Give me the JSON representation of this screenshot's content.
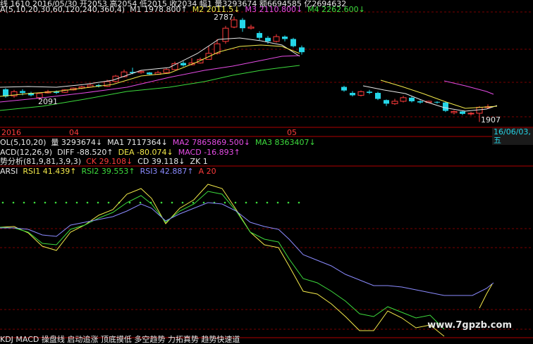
{
  "header": {
    "line1": "线 1610 2016/05/30 开2053 高2054 低2015 收2034 幅1 量3293674 额6694585 亿2694632",
    "ma_prefix": "A(5,10,20,30,60,120,240,360,4)",
    "m1": "M1 1978.800↑",
    "m2": "M2 2011.5↓",
    "m3": "M3 2110.800↓",
    "m4": "M4 2262.600↓"
  },
  "volume_header": {
    "prefix": "OL(5,10,20)",
    "vol": "量 3293674↓",
    "ma1": "MA1 7117364↓",
    "ma2": "MA2 7865869.500↓",
    "ma3": "MA3 8363407↓"
  },
  "macd_header": {
    "prefix": "ACD(12,26,9)",
    "diff": "DIFF -88.520↑",
    "dea": "DEA -80.074↓",
    "macd": "MACD -16.893↑"
  },
  "trend_header": {
    "prefix": "势分析(81,9,81,3,9,3)",
    "ck": "CK 29.108↓",
    "cd": "CD 39.118↓",
    "zk": "ZK 1"
  },
  "rsi_header": {
    "prefix": "ARSI",
    "rsi1": "RSI1 41.439↑",
    "rsi2": "RSI2 39.553↑",
    "rsi3": "RSI3 42.887↑",
    "a": "A 20"
  },
  "axis": {
    "date_labels": [
      "2016",
      "04",
      "05"
    ],
    "selected_date": "16/06/03,五"
  },
  "annotations": {
    "high": "2787",
    "low_left": "2091",
    "low_right": "1907"
  },
  "footer": {
    "text": "KDJ MACD 操盘线 启动追涨 顶底摸低 多空趋势 力拓真势 趋势快速道"
  },
  "watermark": "www.7gpzb.com",
  "colors": {
    "up": "#ff3b3b",
    "down": "#25d6e8",
    "ma1": "#e8e8e8",
    "ma2": "#f3e94a",
    "ma3": "#e64ce6",
    "ma4": "#3ddc3d"
  },
  "chart_data": {
    "type": "candlestick",
    "candles": [
      {
        "o": 2180,
        "c": 2120,
        "h": 2190,
        "l": 2110
      },
      {
        "o": 2125,
        "c": 2160,
        "h": 2175,
        "l": 2110
      },
      {
        "o": 2165,
        "c": 2150,
        "h": 2180,
        "l": 2130
      },
      {
        "o": 2150,
        "c": 2130,
        "h": 2160,
        "l": 2120
      },
      {
        "o": 2110,
        "c": 2145,
        "h": 2150,
        "l": 2091
      },
      {
        "o": 2150,
        "c": 2160,
        "h": 2175,
        "l": 2145
      },
      {
        "o": 2160,
        "c": 2150,
        "h": 2170,
        "l": 2140
      },
      {
        "o": 2155,
        "c": 2175,
        "h": 2180,
        "l": 2150
      },
      {
        "o": 2175,
        "c": 2190,
        "h": 2195,
        "l": 2170
      },
      {
        "o": 2190,
        "c": 2200,
        "h": 2210,
        "l": 2180
      },
      {
        "o": 2200,
        "c": 2215,
        "h": 2230,
        "l": 2195
      },
      {
        "o": 2215,
        "c": 2205,
        "h": 2225,
        "l": 2195
      },
      {
        "o": 2205,
        "c": 2245,
        "h": 2260,
        "l": 2200
      },
      {
        "o": 2245,
        "c": 2290,
        "h": 2300,
        "l": 2240
      },
      {
        "o": 2285,
        "c": 2325,
        "h": 2345,
        "l": 2280
      },
      {
        "o": 2325,
        "c": 2315,
        "h": 2360,
        "l": 2305
      },
      {
        "o": 2320,
        "c": 2330,
        "h": 2340,
        "l": 2310
      },
      {
        "o": 2320,
        "c": 2305,
        "h": 2325,
        "l": 2300
      },
      {
        "o": 2305,
        "c": 2320,
        "h": 2335,
        "l": 2300
      },
      {
        "o": 2320,
        "c": 2345,
        "h": 2355,
        "l": 2315
      },
      {
        "o": 2345,
        "c": 2395,
        "h": 2410,
        "l": 2340
      },
      {
        "o": 2400,
        "c": 2380,
        "h": 2415,
        "l": 2370
      },
      {
        "o": 2385,
        "c": 2400,
        "h": 2440,
        "l": 2380
      },
      {
        "o": 2400,
        "c": 2430,
        "h": 2445,
        "l": 2395
      },
      {
        "o": 2430,
        "c": 2480,
        "h": 2540,
        "l": 2430
      },
      {
        "o": 2480,
        "c": 2560,
        "h": 2600,
        "l": 2470
      },
      {
        "o": 2580,
        "c": 2690,
        "h": 2710,
        "l": 2560
      },
      {
        "o": 2700,
        "c": 2760,
        "h": 2787,
        "l": 2690
      },
      {
        "o": 2760,
        "c": 2690,
        "h": 2775,
        "l": 2660
      },
      {
        "o": 2690,
        "c": 2700,
        "h": 2720,
        "l": 2680
      },
      {
        "o": 2650,
        "c": 2610,
        "h": 2665,
        "l": 2590
      },
      {
        "o": 2610,
        "c": 2580,
        "h": 2625,
        "l": 2560
      },
      {
        "o": 2580,
        "c": 2620,
        "h": 2640,
        "l": 2570
      },
      {
        "o": 2620,
        "c": 2600,
        "h": 2630,
        "l": 2580
      },
      {
        "o": 2600,
        "c": 2540,
        "h": 2610,
        "l": 2530
      },
      {
        "o": 2530,
        "c": 2490,
        "h": 2545,
        "l": 2470
      },
      {
        "gap": true
      },
      {
        "gap": true
      },
      {
        "gap": true
      },
      {
        "gap": true
      },
      {
        "o": 2200,
        "c": 2170,
        "h": 2210,
        "l": 2160
      },
      {
        "o": 2150,
        "c": 2130,
        "h": 2165,
        "l": 2120
      },
      {
        "o": 2130,
        "c": 2160,
        "h": 2170,
        "l": 2120
      },
      {
        "o": 2160,
        "c": 2150,
        "h": 2175,
        "l": 2140
      },
      {
        "o": 2150,
        "c": 2100,
        "h": 2160,
        "l": 2090
      },
      {
        "o": 2090,
        "c": 2060,
        "h": 2095,
        "l": 2040
      },
      {
        "o": 2060,
        "c": 2080,
        "h": 2100,
        "l": 2050
      },
      {
        "o": 2080,
        "c": 2110,
        "h": 2125,
        "l": 2070
      },
      {
        "o": 2110,
        "c": 2080,
        "h": 2120,
        "l": 2070
      },
      {
        "o": 2080,
        "c": 2070,
        "h": 2090,
        "l": 2060
      },
      {
        "o": 2070,
        "c": 2080,
        "h": 2085,
        "l": 2065
      },
      {
        "o": 2075,
        "c": 2070,
        "h": 2080,
        "l": 2060
      },
      {
        "o": 2070,
        "c": 2000,
        "h": 2075,
        "l": 1990
      },
      {
        "o": 1985,
        "c": 1995,
        "h": 2005,
        "l": 1970
      },
      {
        "o": 1995,
        "c": 1975,
        "h": 2000,
        "l": 1965
      },
      {
        "o": 1975,
        "c": 1980,
        "h": 1990,
        "l": 1960
      },
      {
        "o": 1980,
        "c": 2030,
        "h": 2040,
        "l": 1907
      },
      {
        "o": 2030,
        "c": 2034,
        "h": 2054,
        "l": 2015
      }
    ],
    "ylim": [
      1880,
      2820
    ]
  }
}
